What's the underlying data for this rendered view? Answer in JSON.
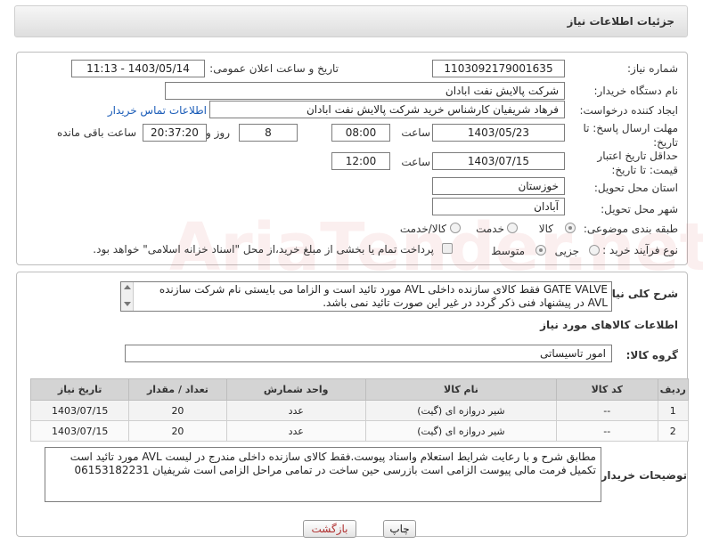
{
  "header": {
    "title": "جزئیات اطلاعات نیاز"
  },
  "form": {
    "need_number_label": "شماره نیاز:",
    "need_number": "1103092179001635",
    "announce_label": "تاریخ و ساعت اعلان عمومی:",
    "announce_value": "1403/05/14 - 11:13",
    "buyer_org_label": "نام دستگاه خریدار:",
    "buyer_org": "شرکت پالایش نفت ابادان",
    "requester_label": "ایجاد کننده درخواست:",
    "requester": "فرهاد شریفیان کارشناس خرید شرکت پالایش نفت ابادان",
    "contact_link": "اطلاعات تماس خریدار",
    "send_deadline_label": "مهلت ارسال پاسخ: تا تاریخ:",
    "send_date": "1403/05/23",
    "time_label": "ساعت",
    "send_time": "08:00",
    "days": "8",
    "days_label": "روز و",
    "remaining": "20:37:20",
    "remaining_label": "ساعت باقی مانده",
    "price_deadline_label": "حداقل تاریخ اعتبار قیمت: تا تاریخ:",
    "price_date": "1403/07/15",
    "price_time": "12:00",
    "province_label": "استان محل تحویل:",
    "province": "خوزستان",
    "city_label": "شهر محل تحویل:",
    "city": "آبادان",
    "category_label": "طبقه بندی موضوعی:",
    "category_options": [
      "کالا",
      "خدمت",
      "کالا/خدمت"
    ],
    "process_label": "نوع فرآیند خرید :",
    "process_options": [
      "جزیی",
      "متوسط"
    ],
    "payment_text": "پرداخت تمام یا بخشی از مبلغ خرید،از محل \"اسناد خزانه اسلامی\" خواهد بود."
  },
  "description": {
    "label": "شرح کلی نیاز:",
    "text": "GATE VALVE فقط کالای سازنده داخلی AVL مورد تائید است و الزاما می بایستی نام شرکت سازنده AVL در پیشنهاد فنی ذکر گردد در غیر این صورت تائید نمی باشد."
  },
  "goods": {
    "section_title": "اطلاعات کالاهای مورد نیاز",
    "group_label": "گروه کالا:",
    "group_value": "امور تاسیساتی",
    "columns": [
      "ردیف",
      "کد کالا",
      "نام کالا",
      "واحد شمارش",
      "تعداد / مقدار",
      "تاریخ نیاز"
    ],
    "rows": [
      [
        "1",
        "--",
        "شیر دروازه ای (گیت)",
        "عدد",
        "20",
        "1403/07/15"
      ],
      [
        "2",
        "--",
        "شیر دروازه ای (گیت)",
        "عدد",
        "20",
        "1403/07/15"
      ]
    ]
  },
  "buyer_notes": {
    "label": "توضیحات خریدار:",
    "text": "مطابق شرح و با رعایت شرایط استعلام واسناد پیوست.فقط کالای سازنده داخلی مندرج در لیست AVL مورد تائید است تکمیل فرمت مالی پیوست الزامی است بازرسی حین ساخت در تمامی مراحل الزامی  است شریفیان 06153182231"
  },
  "buttons": {
    "print": "چاپ",
    "back": "بازگشت"
  },
  "watermark": "AriaTender.net"
}
